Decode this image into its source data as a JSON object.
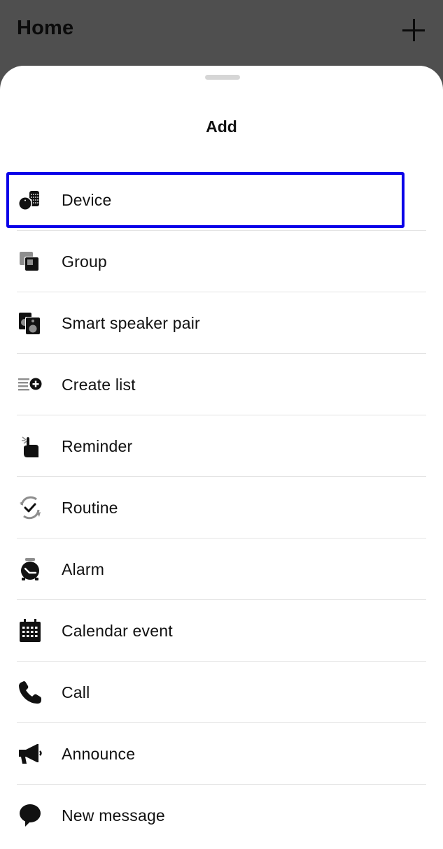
{
  "header": {
    "title": "Home",
    "add_icon": "plus-icon"
  },
  "sheet": {
    "title": "Add",
    "selected_item": "Device",
    "highlight_color": "#0a00e8",
    "items": [
      {
        "label": "Device",
        "icon": "device-icon"
      },
      {
        "label": "Group",
        "icon": "group-icon"
      },
      {
        "label": "Smart speaker pair",
        "icon": "speaker-pair-icon"
      },
      {
        "label": "Create list",
        "icon": "create-list-icon"
      },
      {
        "label": "Reminder",
        "icon": "reminder-icon"
      },
      {
        "label": "Routine",
        "icon": "routine-icon"
      },
      {
        "label": "Alarm",
        "icon": "alarm-icon"
      },
      {
        "label": "Calendar event",
        "icon": "calendar-icon"
      },
      {
        "label": "Call",
        "icon": "phone-icon"
      },
      {
        "label": "Announce",
        "icon": "megaphone-icon"
      },
      {
        "label": "New message",
        "icon": "message-icon"
      }
    ]
  }
}
